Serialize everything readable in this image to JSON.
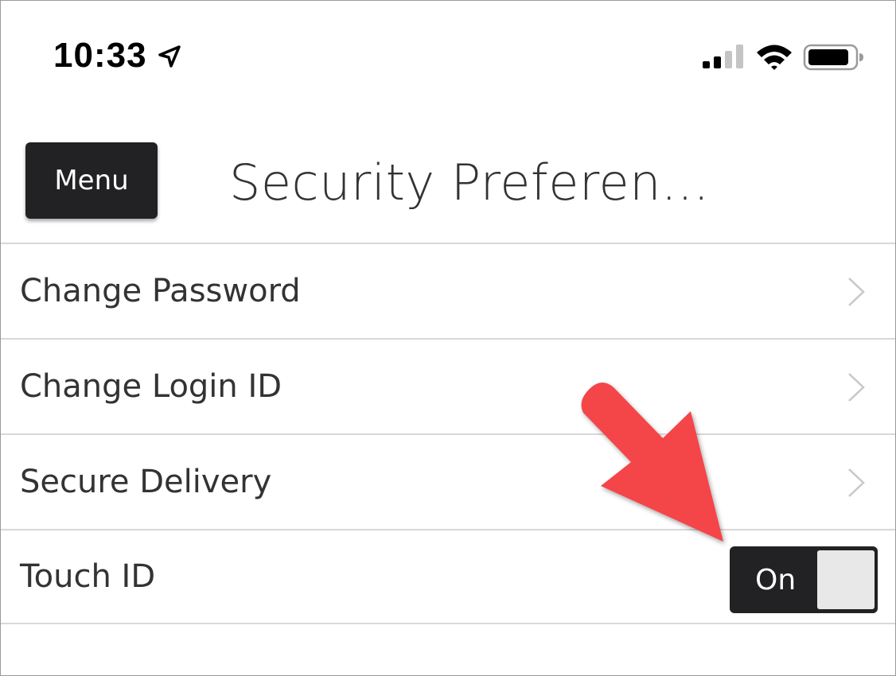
{
  "status_bar": {
    "time": "10:33",
    "icons": [
      "location-arrow-icon",
      "cellular-signal-icon",
      "wifi-icon",
      "battery-icon"
    ]
  },
  "header": {
    "menu_label": "Menu",
    "title": "Security Preferen..."
  },
  "settings": {
    "items": [
      {
        "label": "Change Password",
        "icon": "chevron-right-icon"
      },
      {
        "label": "Change Login ID",
        "icon": "chevron-right-icon"
      },
      {
        "label": "Secure Delivery",
        "icon": "chevron-right-icon"
      },
      {
        "label": "Touch ID",
        "toggle_label": "On",
        "toggle_state": true
      }
    ]
  },
  "colors": {
    "dark": "#222123",
    "text": "#333333",
    "divider": "#d8d8d8",
    "arrow": "#f44448"
  }
}
